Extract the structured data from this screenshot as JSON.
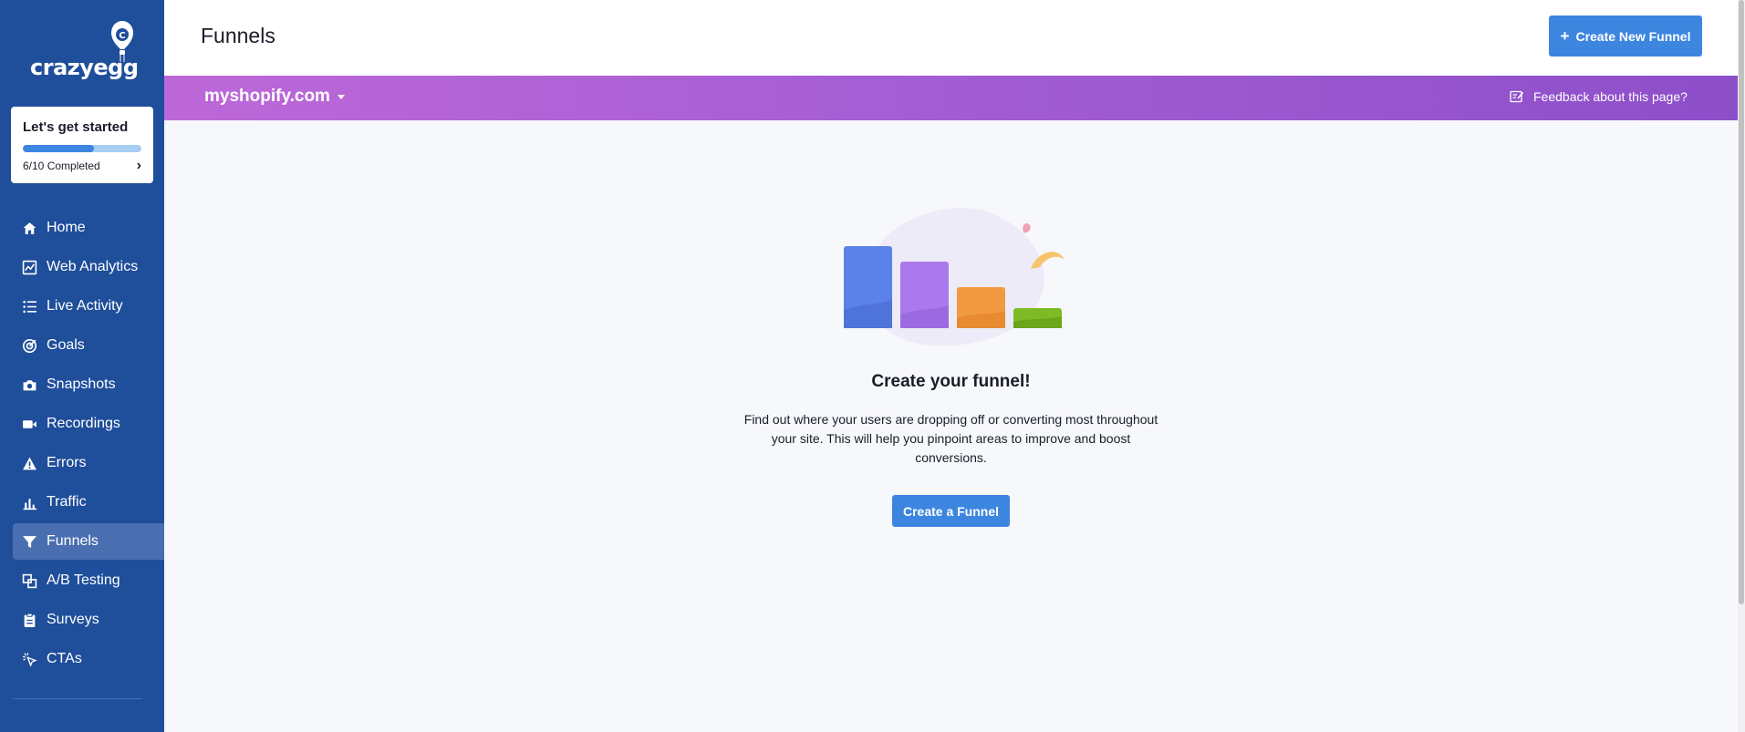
{
  "logo": {
    "text": "crazyegg"
  },
  "onboarding": {
    "title": "Let's get started",
    "completed": 6,
    "total": 10,
    "status_text": "6/10 Completed"
  },
  "sidebar": {
    "items": [
      {
        "label": "Home",
        "icon": "home-icon",
        "active": false
      },
      {
        "label": "Web Analytics",
        "icon": "chart-icon",
        "active": false
      },
      {
        "label": "Live Activity",
        "icon": "list-icon",
        "active": false
      },
      {
        "label": "Goals",
        "icon": "target-icon",
        "active": false
      },
      {
        "label": "Snapshots",
        "icon": "camera-icon",
        "active": false
      },
      {
        "label": "Recordings",
        "icon": "video-icon",
        "active": false
      },
      {
        "label": "Errors",
        "icon": "warning-icon",
        "active": false
      },
      {
        "label": "Traffic",
        "icon": "bar-chart-icon",
        "active": false
      },
      {
        "label": "Funnels",
        "icon": "funnel-icon",
        "active": true
      },
      {
        "label": "A/B Testing",
        "icon": "ab-test-icon",
        "active": false
      },
      {
        "label": "Surveys",
        "icon": "clipboard-icon",
        "active": false
      },
      {
        "label": "CTAs",
        "icon": "cursor-click-icon",
        "active": false
      }
    ]
  },
  "header": {
    "title": "Funnels",
    "create_button": "Create New Funnel"
  },
  "banner": {
    "site": "myshopify.com",
    "feedback": "Feedback about this page?"
  },
  "empty_state": {
    "title": "Create your funnel!",
    "description": "Find out where your users are dropping off or converting most throughout your site. This will help you pinpoint areas to improve and boost conversions.",
    "button": "Create a Funnel"
  },
  "colors": {
    "sidebar": "#1f4e9a",
    "accent": "#3d86e0",
    "banner_start": "#bd68d9",
    "banner_end": "#8d4fc9"
  }
}
